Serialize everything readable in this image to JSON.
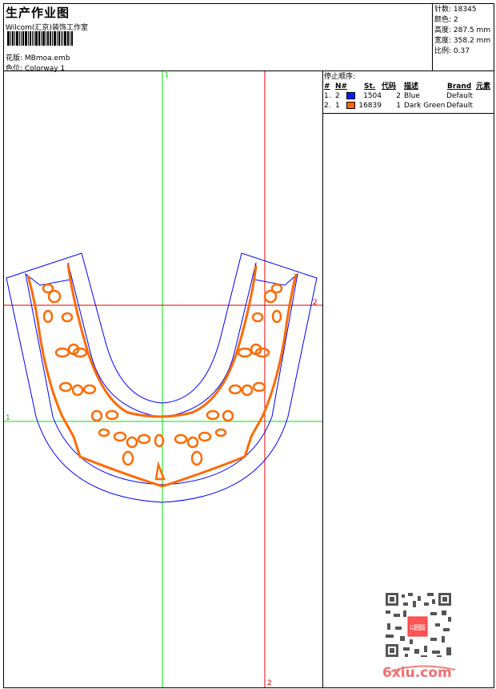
{
  "header": {
    "title": "生产作业图",
    "company": "Wilcom(汇京)装饰工作室",
    "design_label": "花版:",
    "design_value": "MBmoa.emb",
    "colorway_label": "色位:",
    "colorway_value": "Colorway 1"
  },
  "info": [
    {
      "label": "针数:",
      "value": "18345"
    },
    {
      "label": "颜色:",
      "value": "2"
    },
    {
      "label": "高度:",
      "value": "287.5 mm"
    },
    {
      "label": "宽度:",
      "value": "358.2 mm"
    },
    {
      "label": "比例:",
      "value": "0.37"
    }
  ],
  "stop_sequence": {
    "title": "停止顺序:",
    "headers": [
      "#",
      "N#",
      "St.",
      "代码",
      "描述",
      "Brand",
      "元素"
    ],
    "rows": [
      {
        "idx": "1.",
        "n": "2",
        "color": "#0020ff",
        "st": "1504",
        "code": "2",
        "desc": "Blue",
        "brand": "Default"
      },
      {
        "idx": "2.",
        "n": "1",
        "color": "#ff6a00",
        "st": "16839",
        "code": "1",
        "desc": "Dark Green",
        "brand": "Default"
      }
    ]
  },
  "guides": {
    "green_v": "1",
    "green_h": "1",
    "red_h": "2",
    "red_v": "2"
  },
  "watermark": {
    "text": "6xiu.com",
    "seal": "以图版"
  },
  "colors": {
    "outline": "#0000ff",
    "stitch": "#ff6a00",
    "guide1": "#00e000",
    "guide2": "#e00000"
  }
}
